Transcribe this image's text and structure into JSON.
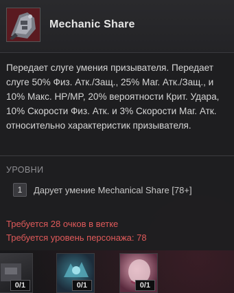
{
  "skill": {
    "name": "Mechanic Share",
    "icon": "mechanic-gauntlet-icon",
    "description": "Передает слуге умения призывателя. Передает слуге 50% Физ. Атк./Защ., 25% Маг. Атк./Защ., и 10% Макс. HP/MP, 20% вероятности Крит. Удара, 10% Скорости Физ. Атк. и 3% Скорости Маг. Атк. относительно характеристик призывателя."
  },
  "levels": {
    "title": "УРОВНИ",
    "items": [
      {
        "level": "1",
        "text": "Дарует умение Mechanical Share [78+]"
      }
    ]
  },
  "requirements": {
    "points": "Требуется 28 очков в ветке",
    "char_level": "Требуется уровень персонажа: 78",
    "color": "#e05a5a"
  },
  "skill_slots": [
    {
      "icon": "skill-slot-icon-1",
      "counter": "0/1"
    },
    {
      "icon": "skill-slot-icon-2",
      "counter": "0/1"
    },
    {
      "icon": "skill-slot-icon-3",
      "counter": "0/1"
    }
  ]
}
